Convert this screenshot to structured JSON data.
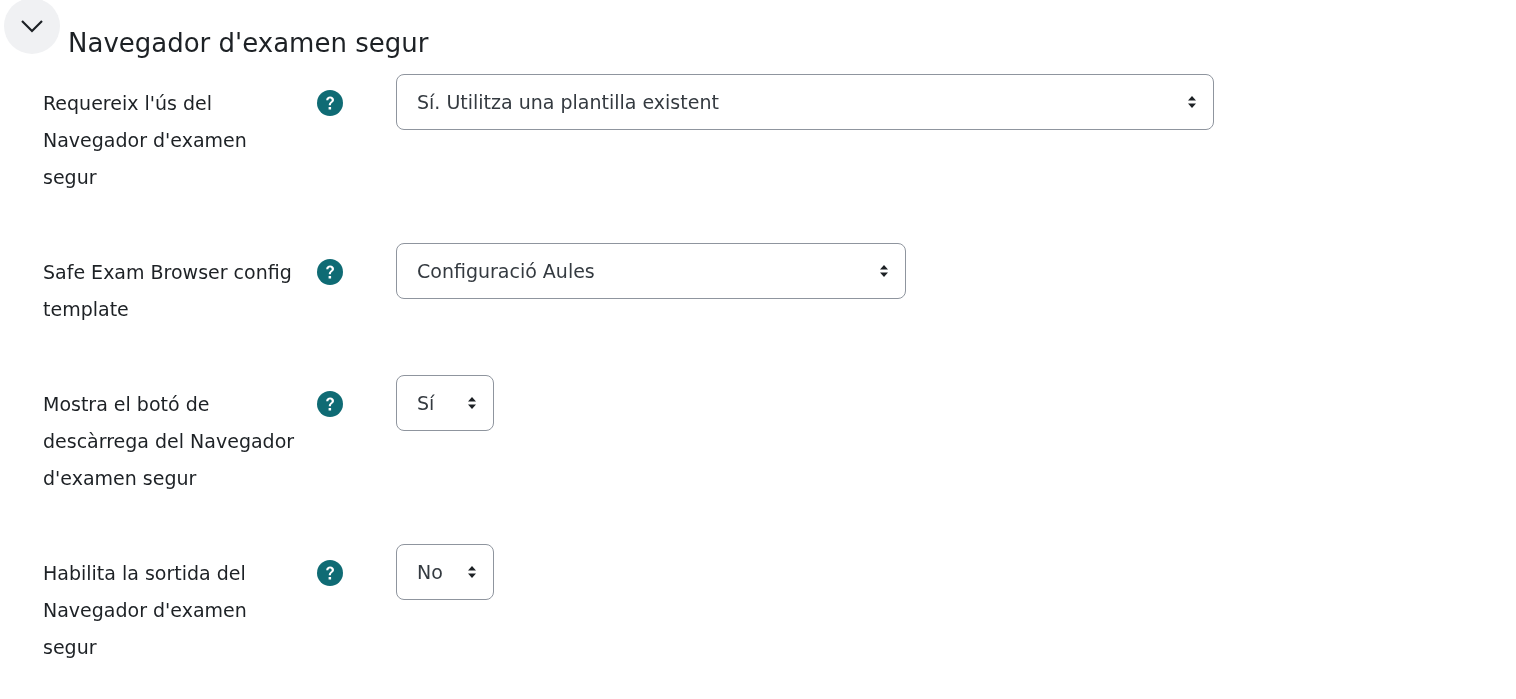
{
  "section": {
    "title": "Navegador d'examen segur",
    "expanded": true
  },
  "fields": [
    {
      "label": "Requereix l'ús del Navegador d'examen segur",
      "value": "Sí. Utilitza una plantilla existent"
    },
    {
      "label": "Safe Exam Browser config template",
      "value": "Configuració Aules"
    },
    {
      "label": "Mostra el botó de descàrrega del Navegador d'examen segur",
      "value": "Sí"
    },
    {
      "label": "Habilita la sortida del Navegador d'examen segur",
      "value": "No"
    }
  ]
}
